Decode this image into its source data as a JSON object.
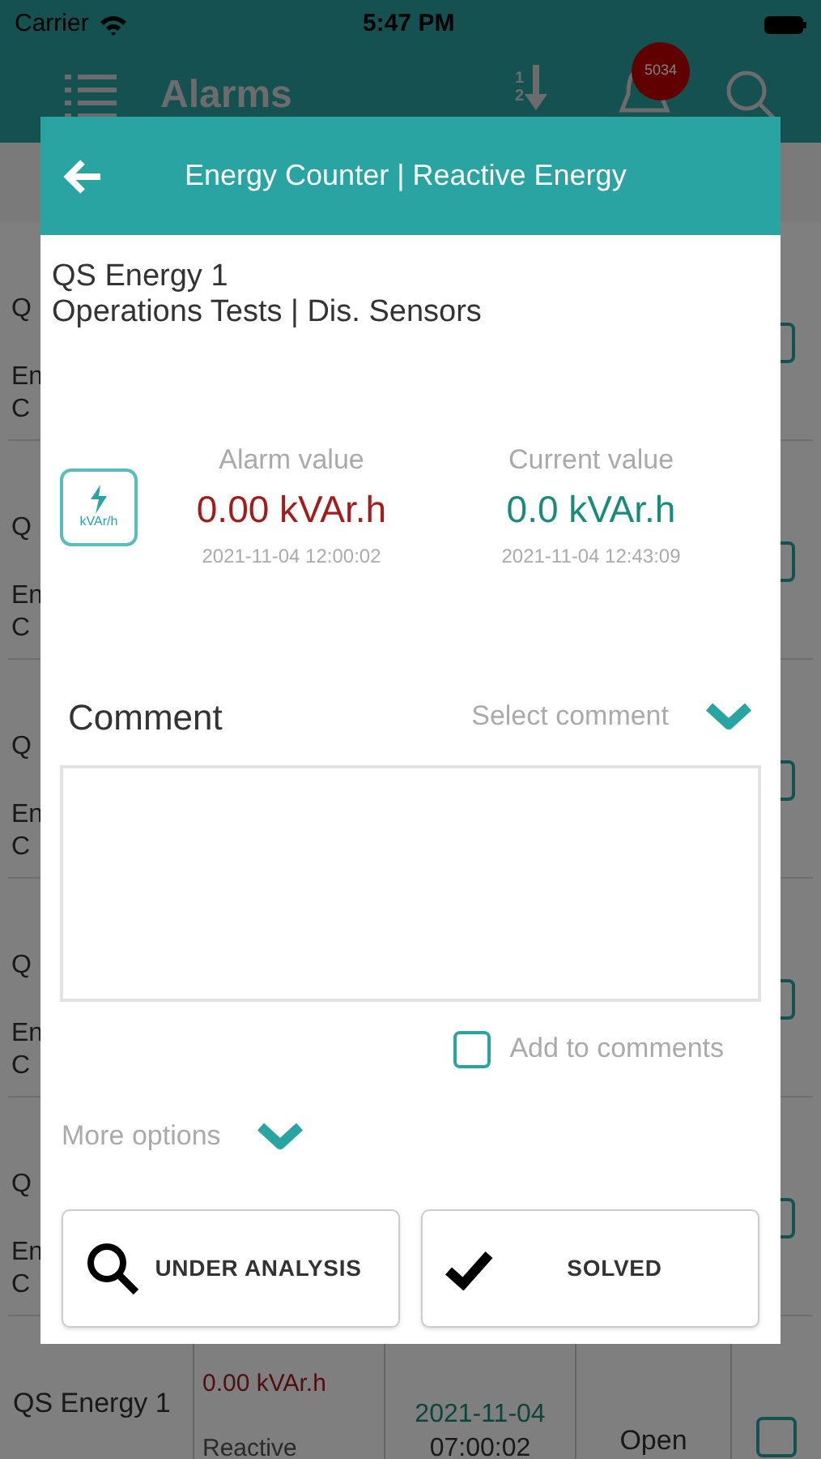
{
  "status_bar": {
    "carrier": "Carrier",
    "time": "5:47 PM"
  },
  "header": {
    "title": "Alarms",
    "sort_digits": [
      "1",
      "2"
    ],
    "badge": "5034"
  },
  "partial_rows": [
    {
      "lines": [
        "Q",
        "En",
        "C"
      ],
      "checked": false
    },
    {
      "lines": [
        "Q",
        "En",
        "C"
      ],
      "checked": false
    },
    {
      "lines": [
        "Q",
        "En",
        "C"
      ],
      "checked": false
    },
    {
      "lines": [
        "Q",
        "En",
        "C"
      ],
      "checked": false
    },
    {
      "lines": [
        "Q",
        "En",
        "C"
      ],
      "checked": false
    }
  ],
  "last_row": {
    "name": "QS Energy 1",
    "value": "0.00 kVAr.h",
    "type": "Reactive",
    "date": "2021-11-04",
    "time": "07:00:02",
    "status": "Open",
    "checked": false
  },
  "dialog": {
    "title": "Energy Counter | Reactive Energy",
    "device": "QS Energy 1",
    "location": "Operations Tests | Dis. Sensors",
    "unit_icon": "kVAr/h",
    "alarm": {
      "label": "Alarm value",
      "value": "0.00 kVAr.h",
      "timestamp": "2021-11-04 12:00:02"
    },
    "current": {
      "label": "Current value",
      "value": "0.0 kVAr.h",
      "timestamp": "2021-11-04 12:43:09"
    },
    "comment": {
      "label": "Comment",
      "select_placeholder": "Select comment"
    },
    "add_to_comments": {
      "label": "Add to comments",
      "checked": false
    },
    "more_options": {
      "label": "More options",
      "expanded": false
    },
    "buttons": [
      {
        "kind": "analysis",
        "label": "UNDER ANALYSIS"
      },
      {
        "kind": "solved",
        "label": "SOLVED"
      }
    ]
  }
}
